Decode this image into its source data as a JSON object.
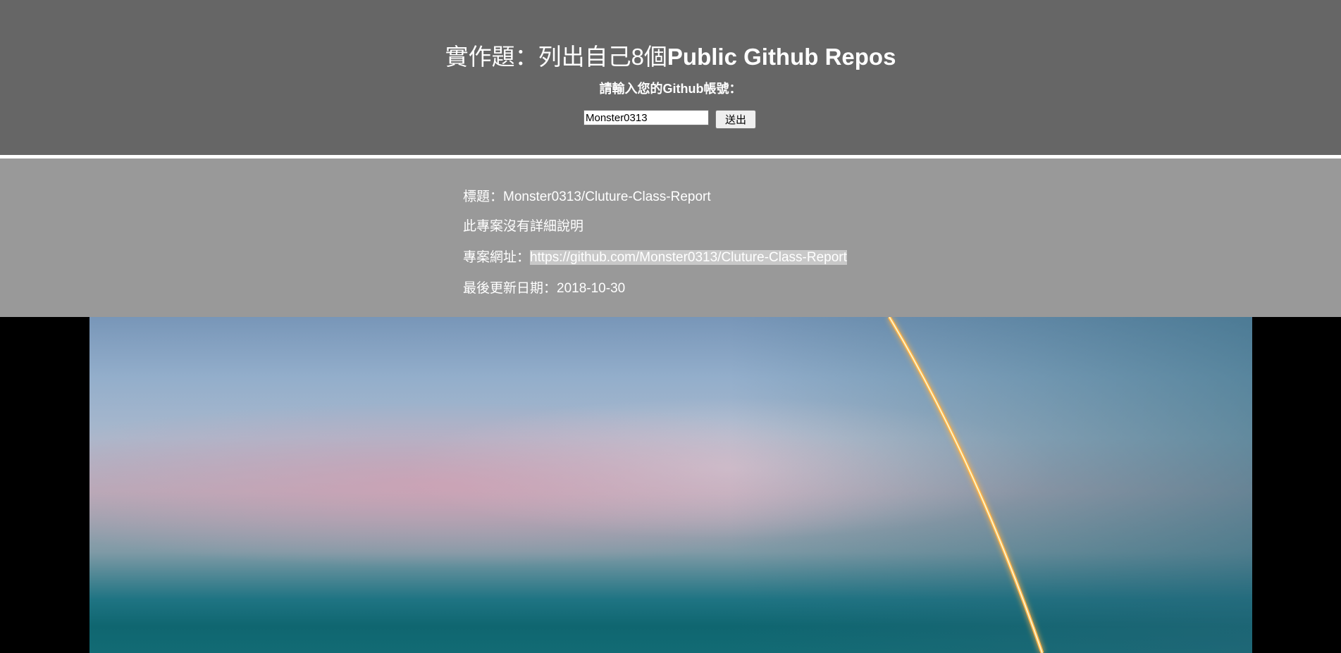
{
  "header": {
    "title_cjk": "實作題：列出自己8個",
    "title_latin": "Public Github Repos",
    "prompt": "請輸入您的Github帳號："
  },
  "form": {
    "username_value": "Monster0313",
    "submit_label": "送出"
  },
  "repo": {
    "title_label": "標題：",
    "title_value": "Monster0313/Cluture-Class-Report",
    "description": "此專案沒有詳細說明",
    "url_label": "專案網址：",
    "url_value": "https://github.com/Monster0313/Cluture-Class-Report",
    "updated_label": "最後更新日期：",
    "updated_value": "2018-10-30"
  },
  "colors": {
    "header_bg": "#666666",
    "panel_bg": "#999999",
    "page_bg": "#000000",
    "rocket_trail": "#ffb347"
  },
  "hero": {
    "icon": "rocket-launch-photo"
  }
}
